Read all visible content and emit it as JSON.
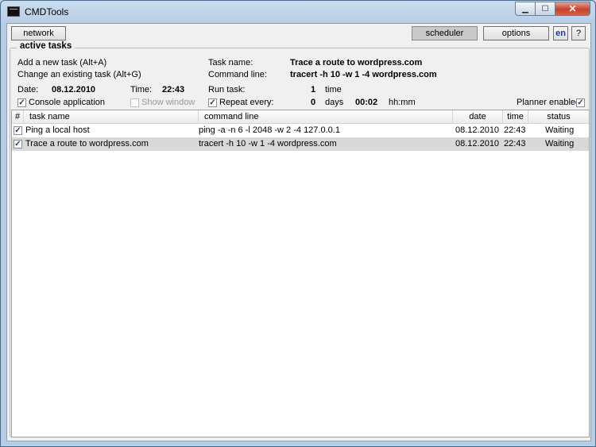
{
  "window": {
    "title": "CMDTools",
    "min_glyph": "▁",
    "max_glyph": "☐",
    "close_glyph": "✕"
  },
  "toolbar": {
    "network": "network",
    "scheduler": "scheduler",
    "options": "options",
    "lang": "en",
    "help": "?"
  },
  "group": {
    "legend": "active tasks"
  },
  "form": {
    "add_task": "Add a new task (Alt+A)",
    "change_task": "Change an existing task (Alt+G)",
    "date_label": "Date:",
    "date_value": "08.12.2010",
    "time_label": "Time:",
    "time_value": "22:43",
    "console_app": "Console application",
    "console_checked": true,
    "show_window": "Show window",
    "show_window_checked": false,
    "task_name_label": "Task name:",
    "task_name_value": "Trace a route to wordpress.com",
    "command_line_label": "Command line:",
    "command_line_value": "tracert -h 10 -w 1 -4 wordpress.com",
    "run_task_label": "Run task:",
    "run_task_value": "1",
    "run_task_unit": "time",
    "repeat_label": "Repeat every:",
    "repeat_checked": true,
    "repeat_days": "0",
    "days_label": "days",
    "repeat_time": "00:02",
    "repeat_time_unit": "hh:mm",
    "planner_enabled": "Planner enabled",
    "planner_checked": true
  },
  "table": {
    "columns": [
      "#",
      "task name",
      "command line",
      "date",
      "time",
      "status"
    ],
    "rows": [
      {
        "checked": true,
        "name": "Ping a local host",
        "cmd": "ping -a -n 6 -l 2048 -w 2 -4 127.0.0.1",
        "date": "08.12.2010",
        "time": "22:43",
        "status": "Waiting"
      },
      {
        "checked": true,
        "name": "Trace a route to wordpress.com",
        "cmd": "tracert -h 10 -w 1 -4 wordpress.com",
        "date": "08.12.2010",
        "time": "22:43",
        "status": "Waiting"
      }
    ]
  }
}
